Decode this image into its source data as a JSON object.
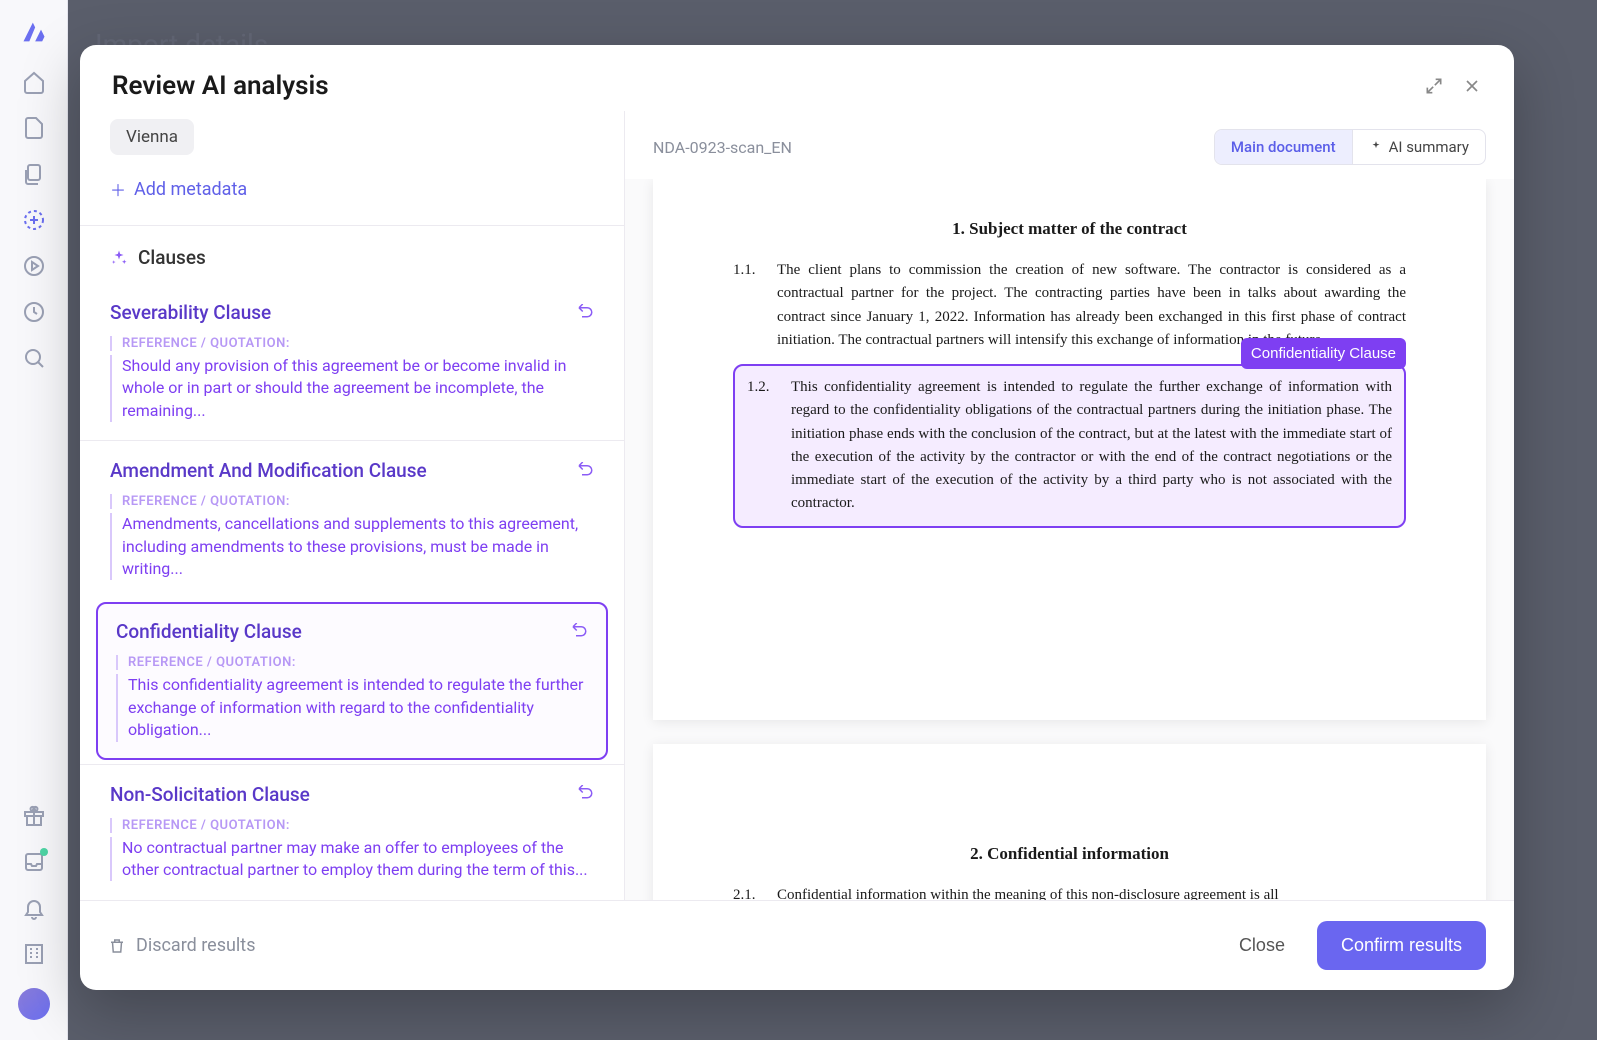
{
  "background_header": "Import details...",
  "modal": {
    "title": "Review AI analysis",
    "metadata_chip": "Vienna",
    "add_metadata_label": "Add metadata",
    "clauses_section_label": "Clauses",
    "reference_label": "REFERENCE / QUOTATION:",
    "clauses": [
      {
        "title": "Severability Clause",
        "text": "Should any provision of this agreement be or become invalid in whole or in part or should the agreement be incomplete, the remaining..."
      },
      {
        "title": "Amendment And Modification Clause",
        "text": "Amendments, cancellations and supplements to this agreement, including amendments to these provisions, must be made in writing..."
      },
      {
        "title": "Confidentiality Clause",
        "text": "This confidentiality agreement is intended to regulate the further exchange of information with regard to the confidentiality obligation..."
      },
      {
        "title": "Non-Solicitation Clause",
        "text": "No contractual partner may make an offer to employees of the other contractual partner to employ them during the term of this..."
      }
    ],
    "document": {
      "name": "NDA-0923-scan_EN",
      "tab_main": "Main document",
      "tab_ai": "AI summary",
      "highlight_tag": "Confidentiality Clause",
      "page1": {
        "section_title": "1.   Subject matter of the contract",
        "p11_num": "1.1.",
        "p11": "The client plans to commission the creation of new software. The contractor is considered as a contractual partner for the project. The contracting parties have been in talks about awarding the contract since January 1, 2022. Information has already been exchanged in this first phase of contract initiation. The contractual partners will intensify this exchange of information in the future.",
        "p12_num": "1.2.",
        "p12": "This confidentiality agreement is intended to regulate the further exchange of information with regard to the confidentiality obligations of the contractual partners during the initiation phase. The initiation phase ends with the conclusion of the contract, but at the latest with the immediate start of the execution of the activity by the contractor or with the end of the contract negotiations or the immediate start of the execution of the activity by a third party who is not associated with the contractor."
      },
      "page2": {
        "section_title": "2.   Confidential information",
        "p21_num": "2.1.",
        "p21": "Confidential information within the meaning of this non-disclosure agreement is all"
      }
    },
    "footer": {
      "discard": "Discard results",
      "close": "Close",
      "confirm": "Confirm results"
    }
  }
}
